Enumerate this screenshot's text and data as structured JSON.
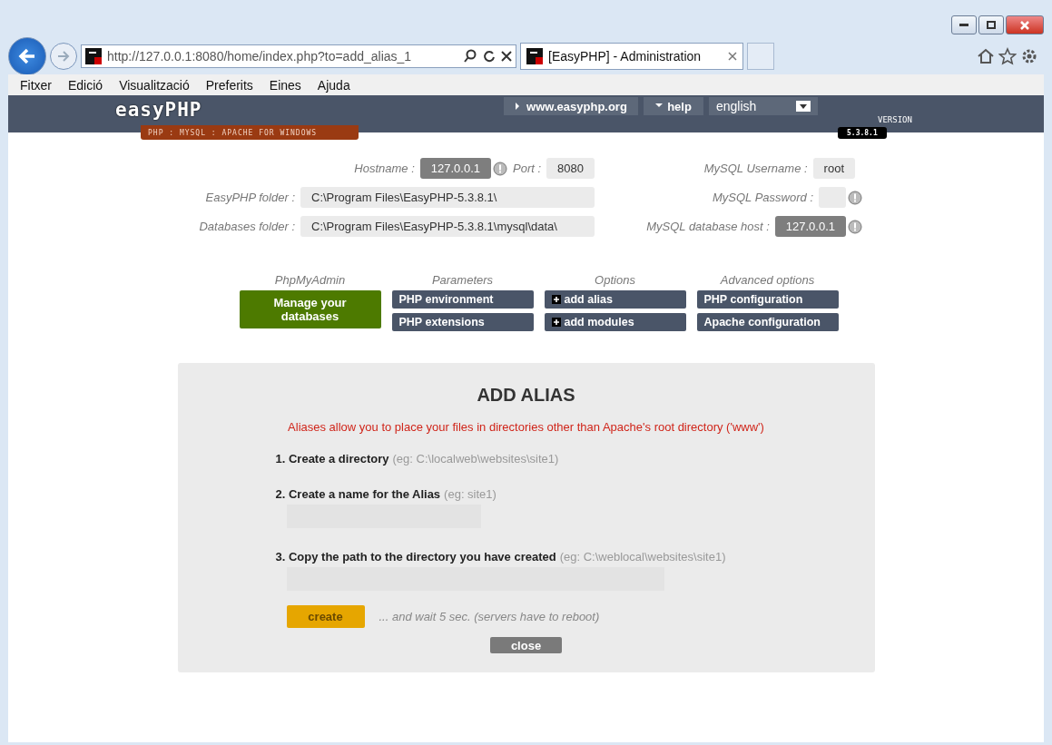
{
  "browser": {
    "url": "http://127.0.0.1:8080/home/index.php?to=add_alias_1",
    "tabs": [
      {
        "title": "[EasyPHP] - Administration",
        "selected": true
      }
    ],
    "menu": [
      "Fitxer",
      "Edició",
      "Visualització",
      "Preferits",
      "Eines",
      "Ajuda"
    ]
  },
  "header": {
    "logo": "easyPHP",
    "tagline": "PHP : MYSQL : APACHE FOR WINDOWS",
    "links": [
      "www.easyphp.org",
      "help"
    ],
    "language": "english",
    "version_label": "VERSION",
    "version": "5.3.8.1"
  },
  "server": {
    "left": [
      {
        "label": "Hostname :",
        "value": "127.0.0.1",
        "warning": true,
        "extra_label": "Port :",
        "extra_value": "8080"
      },
      {
        "label": "EasyPHP folder :",
        "value": "C:\\Program Files\\EasyPHP-5.3.8.1\\",
        "warning": false
      },
      {
        "label": "Databases folder :",
        "value": "C:\\Program Files\\EasyPHP-5.3.8.1\\mysql\\data\\",
        "warning": false
      }
    ],
    "right": [
      {
        "label": "MySQL Username :",
        "value": "root",
        "warning": false
      },
      {
        "label": "MySQL Password :",
        "warning": true
      },
      {
        "label": "MySQL database host :",
        "value": "127.0.0.1",
        "warning": true
      }
    ]
  },
  "sections": [
    {
      "title": "PhpMyAdmin",
      "buttons": [
        {
          "label": "Manage your databases",
          "kind": "primary"
        }
      ]
    },
    {
      "title": "Parameters",
      "buttons": [
        {
          "label": "PHP environment",
          "kind": "normal"
        },
        {
          "label": "PHP extensions",
          "kind": "normal"
        }
      ]
    },
    {
      "title": "Options",
      "buttons": [
        {
          "label": "add alias",
          "kind": "add"
        },
        {
          "label": "add modules",
          "kind": "add"
        }
      ]
    },
    {
      "title": "Advanced options",
      "buttons": [
        {
          "label": "PHP configuration",
          "kind": "normal"
        },
        {
          "label": "Apache configuration",
          "kind": "normal"
        }
      ]
    }
  ],
  "dialog": {
    "title": "ADD ALIAS",
    "description": "Aliases allow you to place your files in directories other than Apache's root directory ('www')",
    "steps": [
      {
        "title": "1. Create a directory",
        "hint": "(eg: C:\\localweb\\websites\\site1)",
        "kind": "text"
      },
      {
        "title": "2. Create a name for the Alias",
        "hint": "(eg: site1)",
        "kind": "short-input"
      },
      {
        "title": "3. Copy the path to the directory you have created",
        "hint": "(eg: C:\\weblocal\\websites\\site1)",
        "kind": "long-input"
      }
    ],
    "create": "create",
    "wait_note": "... and wait 5 sec. (servers have to reboot)",
    "close": "close"
  }
}
